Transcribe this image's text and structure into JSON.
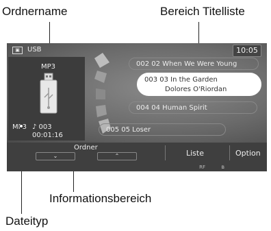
{
  "callouts": {
    "folder_name": "Ordnername",
    "title_list_area": "Bereich Titelliste",
    "info_area": "Informationsbereich",
    "file_type": "Dateityp"
  },
  "status": {
    "source_icon": "usb-icon",
    "source": "USB",
    "clock": "10:05"
  },
  "left_panel": {
    "folder": "MP3",
    "file_type": "MP3",
    "track_no": "♪ 003",
    "elapsed": "00:01:16"
  },
  "tracks": [
    {
      "line1": "002 02 When We Were Young",
      "line2": "",
      "selected": false
    },
    {
      "line1": "003 03 In the Garden",
      "line2": "Dolores O'Riordan",
      "selected": true
    },
    {
      "line1": "004 04 Human Spirit",
      "line2": "",
      "selected": false
    },
    {
      "line1": "005 05 Loser",
      "line2": "",
      "selected": false
    }
  ],
  "bottom": {
    "folder_label": "Ordner",
    "down_glyph": "⌄",
    "up_glyph": "⌃",
    "list_label": "Liste",
    "option_label": "Option",
    "rf": "RF",
    "bt_glyph": "ʙ"
  }
}
